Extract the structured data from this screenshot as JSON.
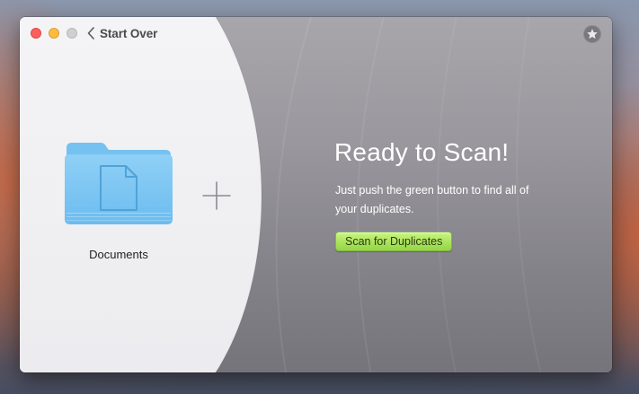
{
  "window": {
    "back_label": "Start Over"
  },
  "source": {
    "folder_name": "Documents",
    "folder_icon": "folder-document-icon",
    "add_icon": "plus-icon"
  },
  "main": {
    "title": "Ready to Scan!",
    "description": "Just push the green button to find all of your duplicates.",
    "scan_button_label": "Scan for Duplicates",
    "favorite_icon": "star-icon"
  },
  "colors": {
    "scan_button": "#a9e35b",
    "close": "#fc605b",
    "minimize": "#fdbc40",
    "right_panel": "#9a989e",
    "left_panel": "#f2f2f4"
  }
}
